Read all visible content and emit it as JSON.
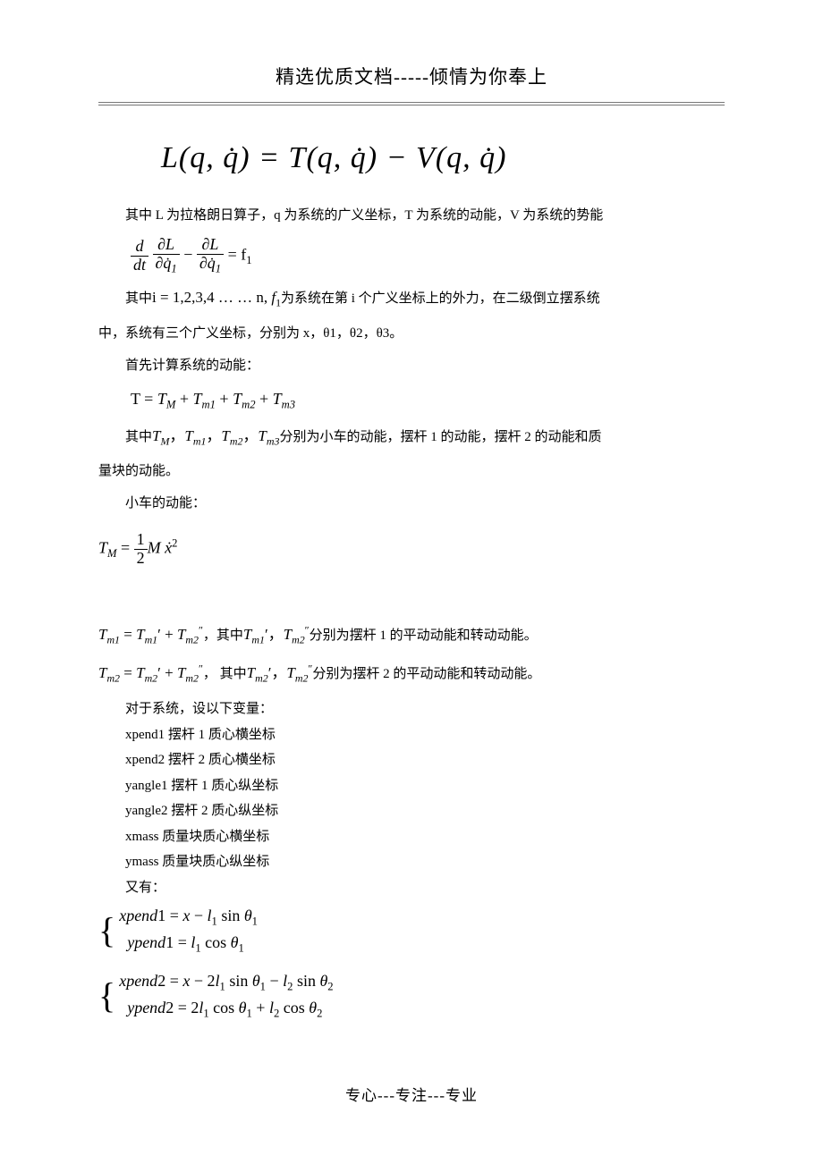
{
  "header": {
    "title": "精选优质文档-----倾情为你奉上"
  },
  "eq_lagrangian": "L(q, q̇) = T(q, q̇) − V(q, q̇)",
  "p1": "其中 L 为拉格朗日算子，q 为系统的广义坐标，T 为系统的动能，V 为系统的势能",
  "eq_euler_lagrange": {
    "lhs_term1_num_d": "d",
    "lhs_term1_den_dt": "dt",
    "lhs_term1_num_dL": "∂L",
    "lhs_term1_den_dq1": "∂q̇",
    "minus": "−",
    "lhs_term2_num_dL": "∂L",
    "lhs_term2_den_dq1": "∂q̇",
    "eq": "= f",
    "sub1": "1"
  },
  "p2_pre": "其中",
  "p2_math": "i = 1,2,3,4 … … n, f₁",
  "p2_post": "为系统在第 i 个广义坐标上的外力，在二级倒立摆系统",
  "p3": "中，系统有三个广义坐标，分别为 x，θ1，θ2，θ3。",
  "p4": "首先计算系统的动能：",
  "eq_T_sum": "T = T_M + T_{m1} + T_{m2} + T_{m3}",
  "p5_pre": "其中",
  "p5_math": "T_M, T_{m1}, T_{m2}, T_{m3}",
  "p5_post": "分别为小车的动能，摆杆 1 的动能，摆杆 2 的动能和质",
  "p6": "量块的动能。",
  "p7": "小车的动能：",
  "eq_TM": "T_M = ½ M ẋ²",
  "eq_Tm1_line_pre": "T_{m1} = T_{m1}' + T_{m2}''",
  "p8_mid": "，其中",
  "p8_math": "T_{m1}', T_{m2}''",
  "p8_post": "分别为摆杆 1 的平动动能和转动动能。",
  "eq_Tm2_line_pre": "T_{m2} = T_{m2}' + T_{m2}''",
  "p9_mid": "， 其中",
  "p9_math": "T_{m2}', T_{m2}''",
  "p9_post": "分别为摆杆 2 的平动动能和转动动能。",
  "p10": "对于系统，设以下变量：",
  "vars": {
    "v1": "xpend1 摆杆 1 质心横坐标",
    "v2": "xpend2 摆杆 2 质心横坐标",
    "v3": "yangle1 摆杆 1 质心纵坐标",
    "v4": "yangle2 摆杆 2 质心纵坐标",
    "v5": "xmass 质量块质心横坐标",
    "v6": "ymass 质量块质心纵坐标",
    "v7": "又有："
  },
  "eq_pend1": {
    "line1": "xpend1 = x − l₁ sin θ₁",
    "line2": " ypend1 = l₁ cos θ₁"
  },
  "eq_pend2": {
    "line1": "xpend2 = x − 2l₁ sin θ₁ − l₂ sin θ₂",
    "line2": " ypend2 = 2l₁ cos θ₁ + l₂ cos θ₂"
  },
  "footer": {
    "text": "专心---专注---专业"
  }
}
